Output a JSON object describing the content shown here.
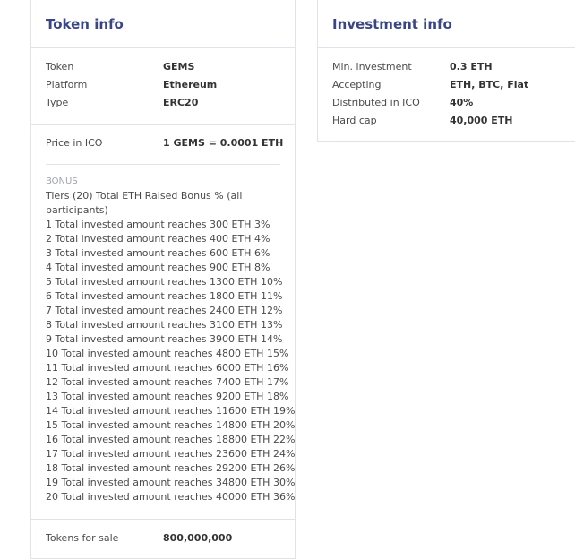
{
  "token_info": {
    "title": "Token info",
    "rows": [
      {
        "label": "Token",
        "value": "GEMS"
      },
      {
        "label": "Platform",
        "value": "Ethereum"
      },
      {
        "label": "Type",
        "value": "ERC20"
      }
    ],
    "price": {
      "label": "Price in ICO",
      "value": "1 GEMS = 0.0001 ETH"
    },
    "bonus": {
      "title": "BONUS",
      "intro": "Tiers (20) Total ETH Raised Bonus % (all participants)",
      "tiers": [
        "1 Total invested amount reaches 300 ETH 3%",
        "2 Total invested amount reaches 400 ETH 4%",
        "3 Total invested amount reaches 600 ETH 6%",
        "4 Total invested amount reaches 900 ETH 8%",
        "5 Total invested amount reaches 1300 ETH 10%",
        "6 Total invested amount reaches 1800 ETH 11%",
        "7 Total invested amount reaches 2400 ETH 12%",
        "8 Total invested amount reaches 3100 ETH 13%",
        "9 Total invested amount reaches 3900 ETH 14%",
        "10 Total invested amount reaches 4800 ETH 15%",
        "11 Total invested amount reaches 6000 ETH 16%",
        "12 Total invested amount reaches 7400 ETH 17%",
        "13 Total invested amount reaches 9200 ETH 18%",
        "14 Total invested amount reaches 11600 ETH 19%",
        "15 Total invested amount reaches 14800 ETH 20%",
        "16 Total invested amount reaches 18800 ETH 22%",
        "17 Total invested amount reaches 23600 ETH 24%",
        "18 Total invested amount reaches 29200 ETH 26%",
        "19 Total invested amount reaches 34800 ETH 30%",
        "20 Total invested amount reaches 40000 ETH 36%"
      ]
    },
    "tokens_for_sale": {
      "label": "Tokens for sale",
      "value": "800,000,000"
    }
  },
  "investment_info": {
    "title": "Investment info",
    "rows": [
      {
        "label": "Min. investment",
        "value": "0.3 ETH"
      },
      {
        "label": "Accepting",
        "value": "ETH, BTC, Fiat"
      },
      {
        "label": "Distributed in ICO",
        "value": "40%"
      },
      {
        "label": "Hard cap",
        "value": "40,000 ETH"
      }
    ]
  },
  "colors": {
    "title": "#3a4683",
    "border": "#e1e3ea",
    "muted": "#a0a3ad"
  }
}
